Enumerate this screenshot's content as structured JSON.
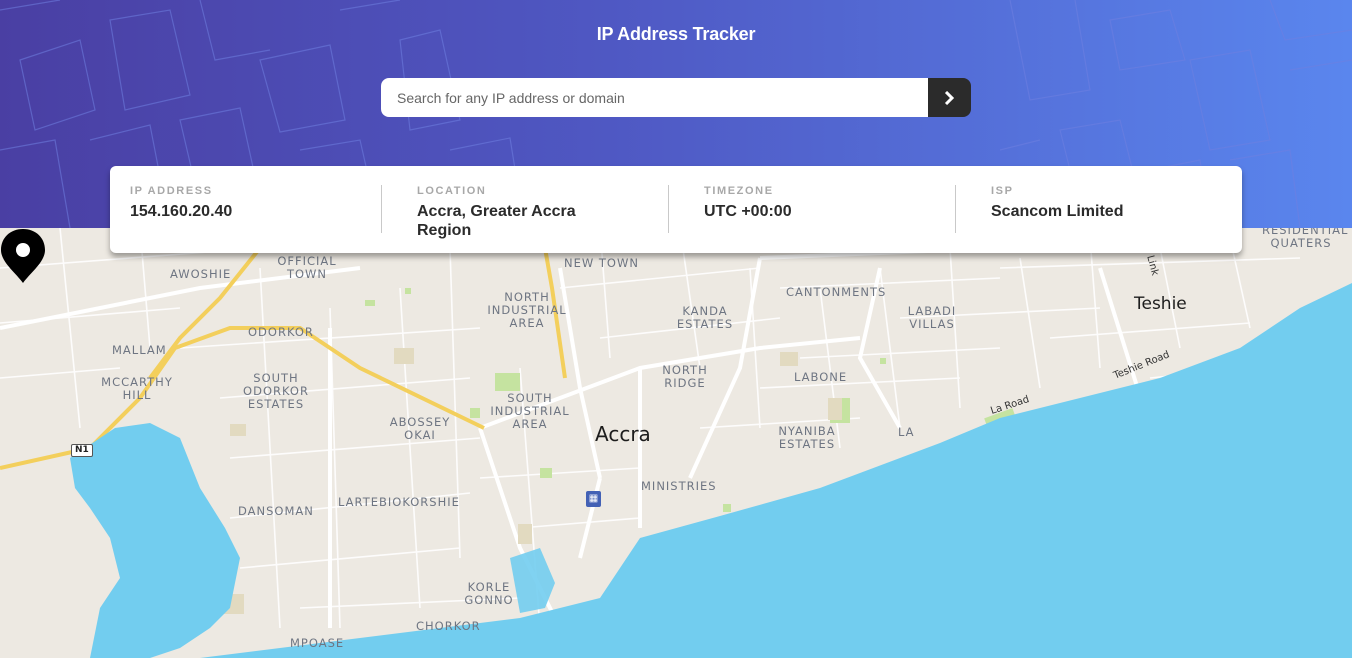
{
  "header": {
    "title": "IP Address Tracker",
    "search": {
      "placeholder": "Search for any IP address or domain",
      "value": "",
      "submit_icon": "chevron-right-icon"
    }
  },
  "info": {
    "ip_label": "IP ADDRESS",
    "ip_value": "154.160.20.40",
    "location_label": "LOCATION",
    "location_value": "Accra, Greater Accra Region",
    "timezone_label": "TIMEZONE",
    "timezone_value": "UTC +00:00",
    "isp_label": "ISP",
    "isp_value": "Scancom Limited"
  },
  "map": {
    "marker_icon": "location-pin-icon",
    "city": "Accra",
    "labels": {
      "awoshie": "AWOSHIE",
      "official_town": "OFFICIAL TOWN",
      "new_town": "NEW TOWN",
      "cantonments": "CANTONMENTS",
      "residential": "RESIDENTIAL QUATERS",
      "teshie": "Teshie",
      "link": "Link",
      "odorkor": "ODORKOR",
      "north_industrial": "NORTH INDUSTRIAL AREA",
      "kanda": "KANDA ESTATES",
      "labadi": "LABADI VILLAS",
      "mallam": "MALLAM",
      "mccarthy": "MCCARTHY HILL",
      "south_odorkor": "SOUTH ODORKOR ESTATES",
      "north_ridge": "NORTH RIDGE",
      "labone": "LABONE",
      "teshie_road": "Teshie Road",
      "abossey": "ABOSSEY OKAI",
      "south_industrial": "SOUTH INDUSTRIAL AREA",
      "la_road": "La Road",
      "nyaniba": "NYANIBA ESTATES",
      "la": "LA",
      "n1": "N1",
      "ministries": "MINISTRIES",
      "lartebiokorshie": "LARTEBIOKORSHIE",
      "dansoman": "DANSOMAN",
      "korle": "KORLE GONNO",
      "chorkor": "CHORKOR",
      "mpoase": "MPOASE"
    },
    "colors": {
      "land": "#ede9e2",
      "sea": "#72cdef",
      "road_major": "#f3cf5c",
      "park": "#c5e3a0"
    }
  }
}
